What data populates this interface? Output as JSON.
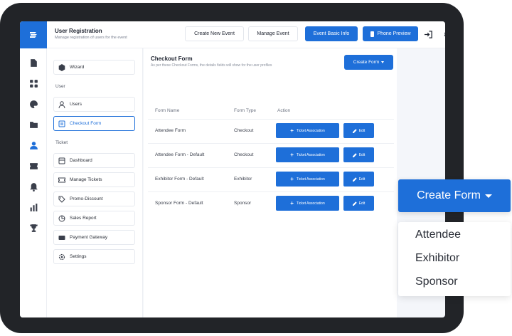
{
  "header": {
    "title": "User Registration",
    "subtitle": "Manage registration of users for the event",
    "buttons": {
      "create_new_event": "Create New Event",
      "manage_event": "Manage Event",
      "event_basic_info": "Event Basic Info",
      "phone_preview": "Phone Preview"
    }
  },
  "rail": {
    "icons": [
      "file-icon",
      "grid-icon",
      "palette-icon",
      "folder-icon",
      "user-icon",
      "ticket-icon",
      "bell-icon",
      "bar-chart-icon",
      "trophy-icon"
    ],
    "active": "user-icon",
    "accent": "#1e6fd9"
  },
  "sidebar": {
    "wizard": "Wizard",
    "user_section": "User",
    "users": "Users",
    "checkout_form": "Checkout Form",
    "ticket_section": "Ticket",
    "ticket_items": [
      "Dashboard",
      "Manage Tickets",
      "Promo-Discount",
      "Sales Report",
      "Payment Gateway",
      "Settings"
    ]
  },
  "main": {
    "title": "Checkout Form",
    "subtitle": "As per these Checkout Forms, the details fields will show for the user profiles",
    "create_button": "Create Form",
    "columns": [
      "Form Name",
      "Form Type",
      "Action"
    ],
    "action_labels": {
      "ticket_association": "Ticket Association",
      "edit": "Edit"
    },
    "rows": [
      {
        "name": "Attendee Form",
        "type": "Checkout"
      },
      {
        "name": "Attendee Form - Default",
        "type": "Checkout"
      },
      {
        "name": "Exhibitor Form - Default",
        "type": "Exhibitor"
      },
      {
        "name": "Sponsor Form - Default",
        "type": "Sponsor"
      }
    ]
  },
  "callout": {
    "button": "Create Form",
    "options": [
      "Attendee",
      "Exhibitor",
      "Sponsor"
    ]
  }
}
